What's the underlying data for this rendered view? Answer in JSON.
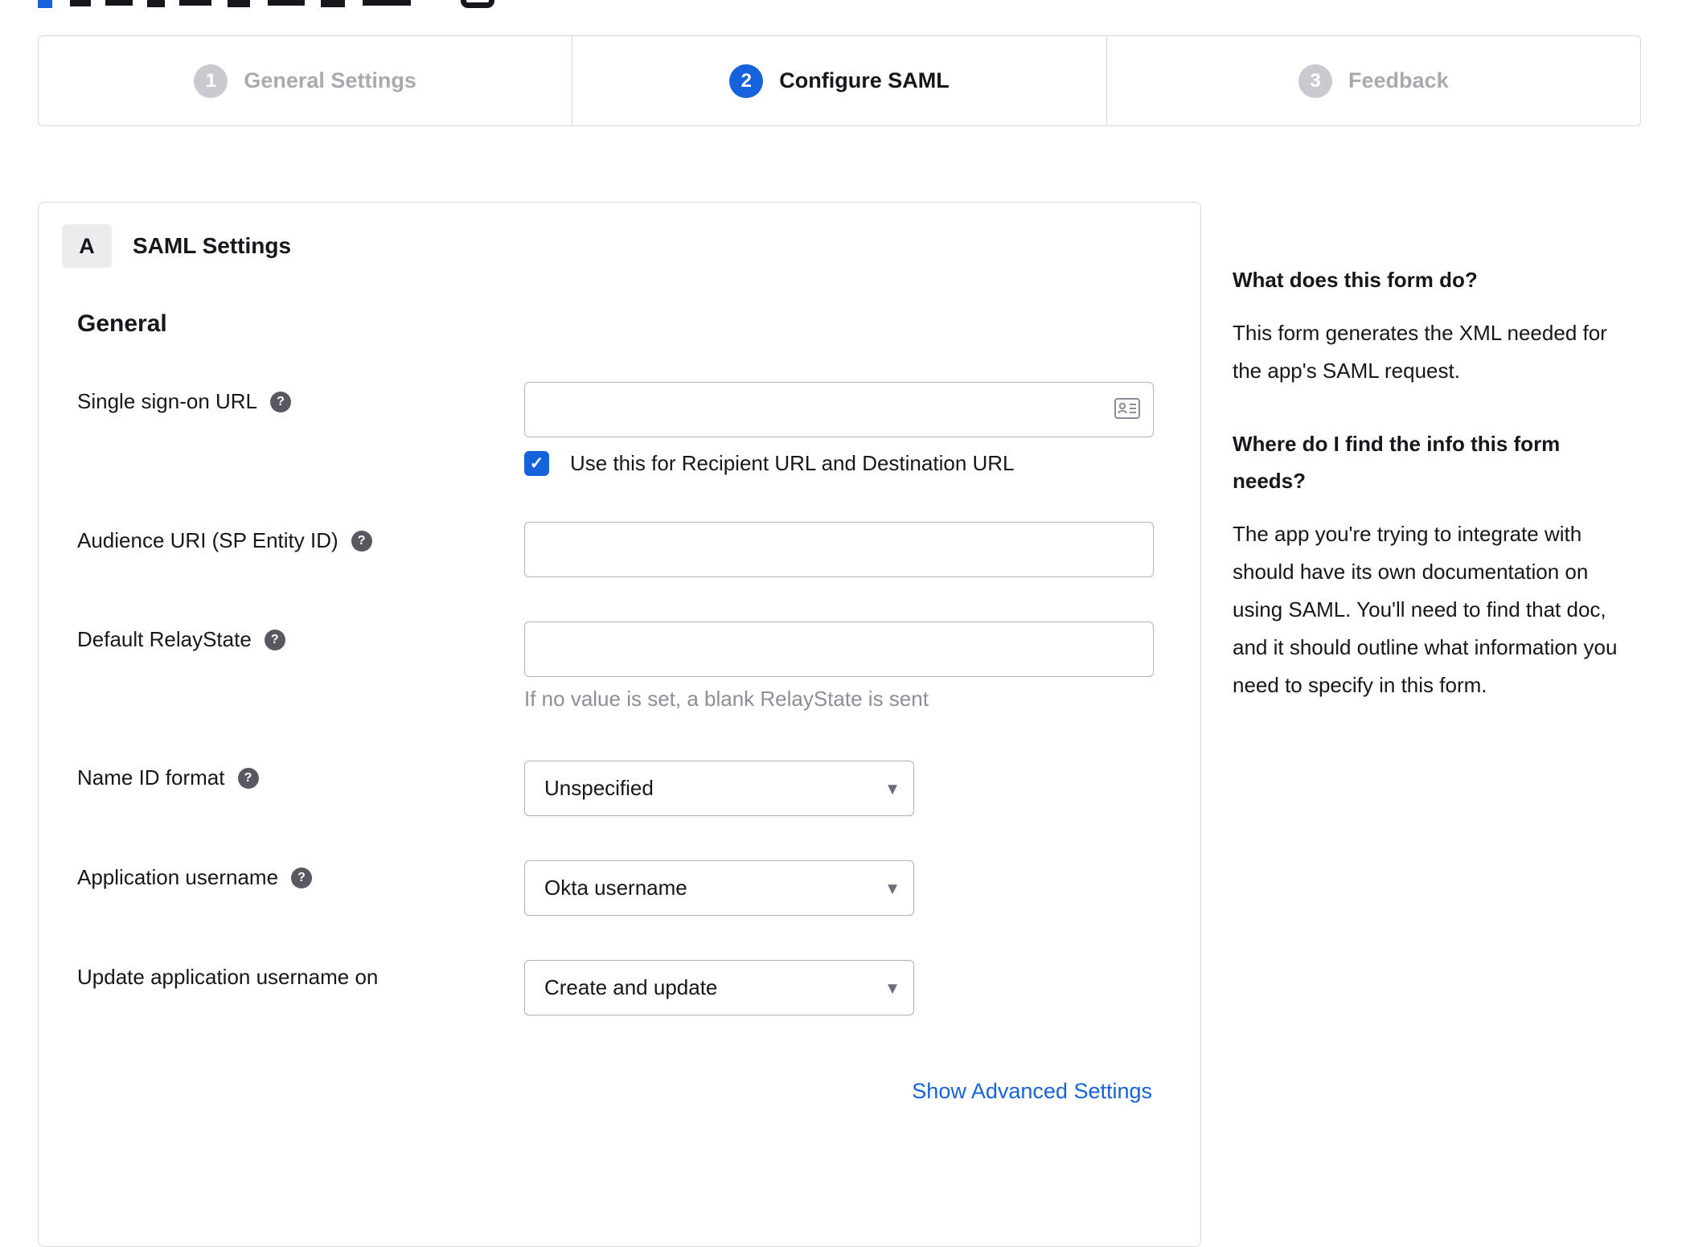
{
  "colors": {
    "accent": "#1662dd",
    "border": "#d7d7dc",
    "inactive_gray": "#c9c9cf",
    "hint_gray": "#8e8e98"
  },
  "icons": {
    "help": "?",
    "check": "✓",
    "caret": "▾"
  },
  "stepper": {
    "steps": [
      {
        "number": "1",
        "label": "General Settings",
        "state": "inactive"
      },
      {
        "number": "2",
        "label": "Configure SAML",
        "state": "active"
      },
      {
        "number": "3",
        "label": "Feedback",
        "state": "inactive"
      }
    ]
  },
  "panel": {
    "badge": "A",
    "title": "SAML Settings",
    "section_heading": "General",
    "fields": [
      {
        "label": "Single sign-on URL",
        "type": "text",
        "value": "",
        "checkbox_label": "Use this for Recipient URL and Destination URL",
        "checkbox_checked": true
      },
      {
        "label": "Audience URI (SP Entity ID)",
        "type": "text",
        "value": ""
      },
      {
        "label": "Default RelayState",
        "type": "text",
        "value": "",
        "hint": "If no value is set, a blank RelayState is sent"
      },
      {
        "label": "Name ID format",
        "type": "select",
        "value": "Unspecified"
      },
      {
        "label": "Application username",
        "type": "select",
        "value": "Okta username"
      },
      {
        "label": "Update application username on",
        "type": "select",
        "value": "Create and update"
      }
    ],
    "advanced_link": "Show Advanced Settings"
  },
  "help_sidebar": {
    "heading1": "What does this form do?",
    "body1": "This form generates the XML needed for the app's SAML request.",
    "heading2": "Where do I find the info this form needs?",
    "body2": "The app you're trying to integrate with should have its own documentation on using SAML. You'll need to find that doc, and it should outline what information you need to specify in this form."
  }
}
